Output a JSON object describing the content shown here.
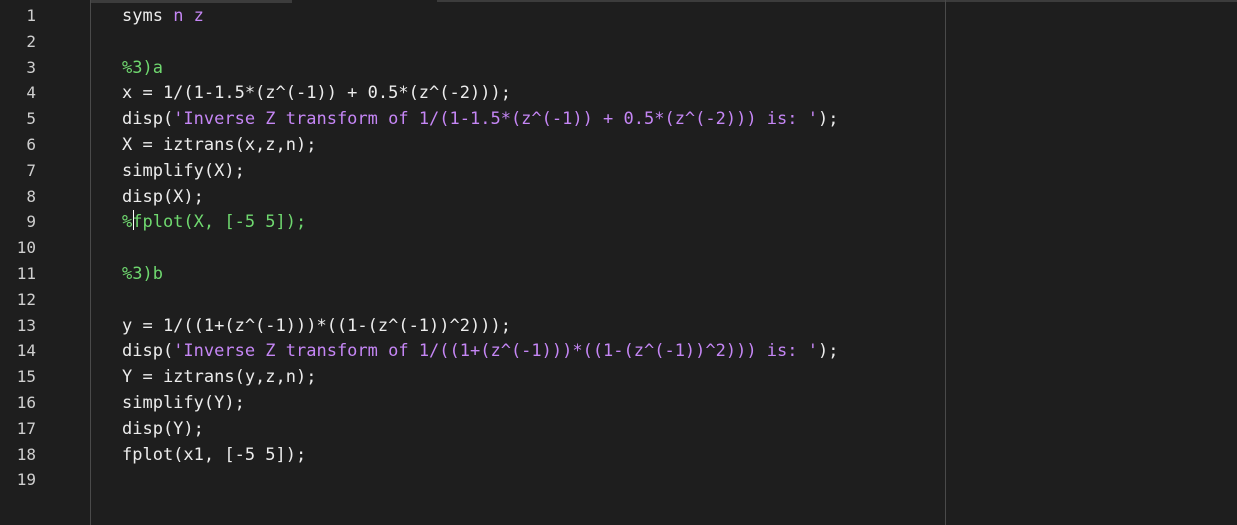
{
  "editor": {
    "line_numbers": [
      "1",
      "2",
      "3",
      "4",
      "5",
      "6",
      "7",
      "8",
      "9",
      "10",
      "11",
      "12",
      "13",
      "14",
      "15",
      "16",
      "17",
      "18",
      "19"
    ],
    "lines": [
      {
        "segments": [
          {
            "t": "syms ",
            "c": "code"
          },
          {
            "t": "n z",
            "c": "kw-arg"
          }
        ]
      },
      {
        "segments": []
      },
      {
        "segments": [
          {
            "t": "%3)a",
            "c": "comment"
          }
        ]
      },
      {
        "segments": [
          {
            "t": "x = 1/(1-1.5*(z^(-1)) + 0.5*(z^(-2)));",
            "c": "code"
          }
        ]
      },
      {
        "segments": [
          {
            "t": "disp(",
            "c": "code"
          },
          {
            "t": "'Inverse Z transform of 1/(1-1.5*(z^(-1)) + 0.5*(z^(-2))) is: '",
            "c": "str"
          },
          {
            "t": ");",
            "c": "code"
          }
        ]
      },
      {
        "segments": [
          {
            "t": "X = iztrans(x,z,n);",
            "c": "code"
          }
        ]
      },
      {
        "segments": [
          {
            "t": "simplify(X);",
            "c": "code"
          }
        ]
      },
      {
        "segments": [
          {
            "t": "disp(X);",
            "c": "code"
          }
        ]
      },
      {
        "segments": [
          {
            "t": "%fplot(X, [-5 5]);",
            "c": "comment"
          }
        ]
      },
      {
        "segments": []
      },
      {
        "segments": [
          {
            "t": "%3)b",
            "c": "comment"
          }
        ]
      },
      {
        "segments": []
      },
      {
        "segments": [
          {
            "t": "y = 1/((1+(z^(-1)))*((1-(z^(-1))^2)));",
            "c": "code"
          }
        ]
      },
      {
        "segments": [
          {
            "t": "disp(",
            "c": "code"
          },
          {
            "t": "'Inverse Z transform of 1/((1+(z^(-1)))*((1-(z^(-1))^2))) is: '",
            "c": "str"
          },
          {
            "t": ");",
            "c": "code"
          }
        ]
      },
      {
        "segments": [
          {
            "t": "Y = iztrans(y,z,n);",
            "c": "code"
          }
        ]
      },
      {
        "segments": [
          {
            "t": "simplify(Y);",
            "c": "code"
          }
        ]
      },
      {
        "segments": [
          {
            "t": "disp(Y);",
            "c": "code"
          }
        ]
      },
      {
        "segments": [
          {
            "t": "fplot(x1, [-5 5]);",
            "c": "code"
          }
        ]
      },
      {
        "segments": []
      }
    ]
  },
  "colors": {
    "background": "#1e1e1e",
    "code": "#ececec",
    "string": "#c586f5",
    "comment": "#6fd86f",
    "line_number": "#cfcfcf"
  }
}
